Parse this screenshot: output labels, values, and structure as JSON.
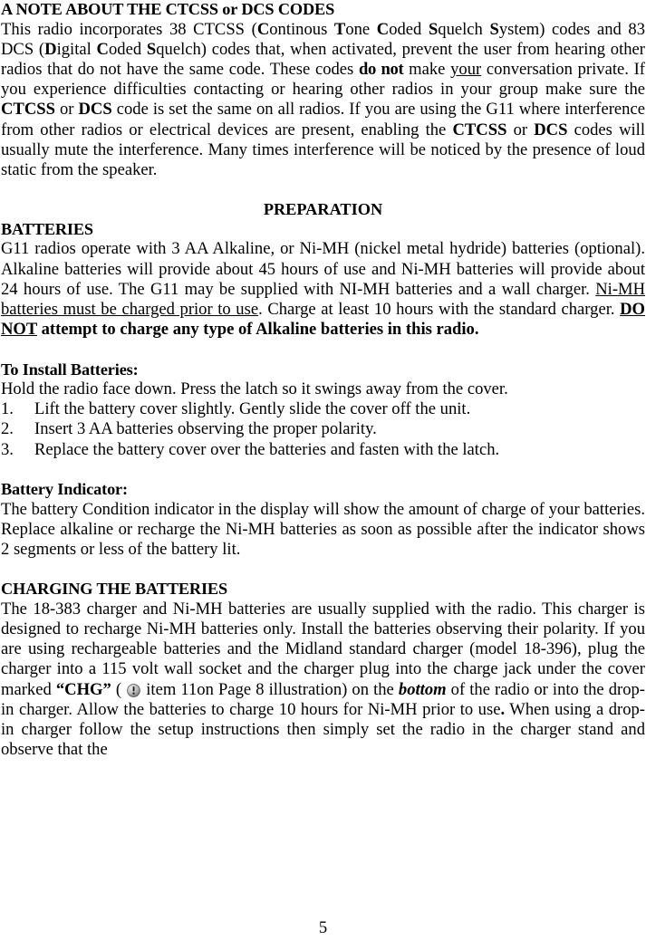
{
  "document": {
    "page_number": "5",
    "sections": [
      {
        "id": "ctcss-note",
        "heading": "A NOTE ABOUT THE CTCSS or DCS CODES",
        "heading_align": "left"
      },
      {
        "id": "preparation",
        "heading": "PREPARATION",
        "heading_align": "center"
      },
      {
        "id": "batteries",
        "heading": "BATTERIES",
        "heading_align": "left"
      },
      {
        "id": "install-batteries",
        "heading": "To Install Batteries:",
        "heading_align": "left"
      },
      {
        "id": "battery-indicator",
        "heading": "Battery Indicator:",
        "heading_align": "left"
      },
      {
        "id": "charging",
        "heading": "CHARGING THE BATTERIES",
        "heading_align": "left"
      }
    ],
    "paragraphs": {
      "ctcss_note": {
        "p1_a": "This radio incorporates 38 CTCSS (",
        "p1_c1": "C",
        "p1_c1b": "ontinous ",
        "p1_t": "T",
        "p1_tb": "one ",
        "p1_c2": "C",
        "p1_c2b": "oded ",
        "p1_s1": "S",
        "p1_s1b": "quelch ",
        "p1_sy": "S",
        "p1_syb": "ystem) codes and 83 DCS (",
        "p1_d": "D",
        "p1_db": "igital ",
        "p1_c3": "C",
        "p1_c3b": "oded ",
        "p1_s2": "S",
        "p1_s2b": "quelch) codes that, when activated, prevent the user from hearing other radios that do not have the same code. These codes ",
        "p1_donot": "do not",
        "p1_make": " make ",
        "p1_your": "your",
        "p1_rest": " conversation private. If you experience difficulties contacting or hearing other radios in your group make sure the ",
        "p1_ctcss1": "CTCSS",
        "p1_or1": " or ",
        "p1_dcs1": "DCS",
        "p1_mid": " code is set the same on all radios. If you are using the G11 where interference from other radios or electrical devices are present, enabling the ",
        "p1_ctcss2": "CTCSS",
        "p1_or2": " or ",
        "p1_dcs2": "DCS",
        "p1_end": " codes will usually mute the interference. Many times interference will be noticed by the presence of loud static from the speaker."
      },
      "batteries": {
        "b1_a": "G11 radios operate with 3 AA Alkaline, or Ni-MH (nickel metal hydride) batteries (optional). Alkaline batteries will provide about 45 hours of use and Ni-MH batteries will provide about 24 hours of use. The G11 may be supplied with NI-MH batteries and a wall charger. ",
        "b1_underline": "Ni-MH batteries must be charged prior to use",
        "b1_mid": ". Charge at least 10 hours with the standard charger. ",
        "b1_donot": "DO NOT",
        "b1_bold": " attempt to charge any type of Alkaline batteries in this radio."
      },
      "install": {
        "intro": "Hold the radio face down. Press the latch so it swings away from the cover.",
        "items": [
          {
            "num": "1.",
            "text": "Lift the battery cover slightly. Gently slide the cover off the unit."
          },
          {
            "num": "2.",
            "text": "Insert 3 AA batteries observing the proper polarity."
          },
          {
            "num": "3.",
            "text": "Replace the battery cover over the batteries and fasten with the latch."
          }
        ]
      },
      "battery_indicator": {
        "text": "The battery Condition indicator in the display will show the amount of charge of your batteries. Replace alkaline or recharge the Ni-MH batteries as soon as possible after the indicator shows 2 segments or less of the battery lit."
      },
      "charging": {
        "c1_a": "The 18-383 charger and Ni-MH batteries are usually supplied with the radio. This charger is designed to recharge Ni-MH batteries only.  Install the batteries observing their polarity. If you are using rechargeable batteries and the Midland standard charger (model 18-396), plug the charger into a 115 volt wall socket and the charger plug into the charge jack under the cover marked ",
        "c1_chg": "“CHG”",
        "c1_paren_open": " ( ",
        "c1_after_icon": " item 11on Page 8 illustration) on the ",
        "c1_bottom": "bottom",
        "c1_b": " of the radio or into the drop-in charger. Allow the batteries to charge 10 hours for Ni-MH prior to use",
        "c1_period": ".",
        "c1_end": "  When using a drop-in charger follow the setup instructions then simply set the radio in the charger stand and observe that the"
      }
    },
    "icons": {
      "chg_jack_icon": "exclamation-circle-icon"
    },
    "colors": {
      "text": "#000000",
      "background": "#ffffff",
      "icon_fill": "#9a9a9a"
    }
  }
}
